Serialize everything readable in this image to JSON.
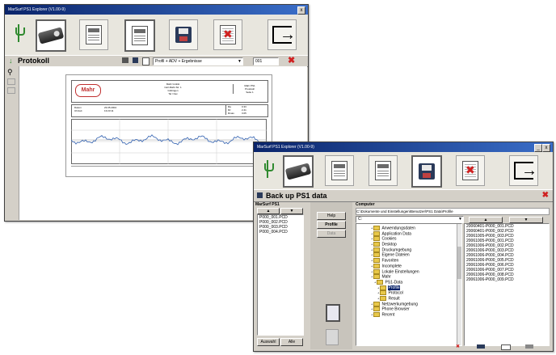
{
  "window1": {
    "title": "MarSurf PS1 Explorer (V1.00-9)",
    "close_label": "x",
    "section_title": "Protokoll",
    "profile_select": "Profil + ADV + Ergebnisse",
    "page_field": "001",
    "report": {
      "logo": "Mahr",
      "header_lines": [
        "Mahr GmbH",
        "Carl-Mahr-Str. 1",
        "Göttingen",
        "Tel / Fax"
      ],
      "header_right": [
        "Mahr PS1",
        "Protokoll",
        "Seite 1"
      ],
      "info_left": [
        "Datum",
        "Uhrzeit"
      ],
      "info_mid": [
        "23.05.2004",
        "13:23:11"
      ],
      "info_right": [
        "Ra",
        "Rz",
        "Rmax"
      ],
      "info_right_vals": [
        "0.33",
        "2.41",
        "3.05"
      ]
    }
  },
  "window2": {
    "title": "MarSurf PS1 Explorer (V1.00-9)",
    "btn_min": "_",
    "btn_close": "x",
    "section_title": "Back up PS1 data",
    "left_panel_title": "MarSurf PS1",
    "left_files": [
      "P000_001.PCD",
      "P000_002.PCD",
      "P000_003.PCD",
      "P000_004.PCD"
    ],
    "mid_buttons": [
      "Help",
      "Profile",
      "Data"
    ],
    "computer_label": "Computer",
    "path": "C:\\Dokumente und Einstellungen\\Benutzer\\PS1 Data\\Profile",
    "drive": "C:",
    "tree": [
      "Anwendungsdaten",
      "Application Data",
      "Cookies",
      "Desktop",
      "Druckumgebung",
      "Eigene Dateien",
      "Favoriten",
      "Incomplete",
      "Lokale Einstellungen",
      "Mahr",
      "PS1-Data",
      "Profile",
      "Protocol",
      "Result",
      "Netzwerkumgebung",
      "Phone Browser",
      "Recent"
    ],
    "right_files": [
      "20060401-P000_001.PCD",
      "20060401-P000_002.PCD",
      "20061005-P000_003.PCD",
      "20061005-P000_001.PCD",
      "20061006-P000_002.PCD",
      "20061006-P000_003.PCD",
      "20061006-P000_004.PCD",
      "20061006-P000_005.PCD",
      "20061006-P000_006.PCD",
      "20061006-P000_007.PCD",
      "20061006-P000_008.PCD",
      "20061006-P000_009.PCD"
    ],
    "bottom_buttons": [
      "Auswahl",
      "Alle"
    ]
  },
  "colors": {
    "titlebar": "#0a246a",
    "window_bg": "#d4d0c8",
    "close_red": "#d02020",
    "profile_blue": "#3060b0"
  },
  "icons": [
    "usb-icon",
    "device-icon",
    "report-icon",
    "disk-icon",
    "delete-icon",
    "exit-icon"
  ]
}
